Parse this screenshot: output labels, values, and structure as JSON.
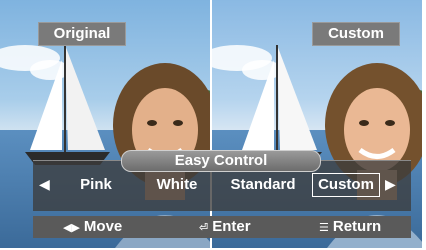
{
  "labels": {
    "left": "Original",
    "right": "Custom"
  },
  "osd": {
    "title": "Easy Control",
    "options": [
      "Pink",
      "White",
      "Standard",
      "Custom"
    ],
    "selected_option": "Custom",
    "left_arrow_icon": "left-arrow-icon",
    "right_arrow_icon": "right-arrow-icon",
    "help": {
      "move": "Move",
      "enter": "Enter",
      "return": "Return"
    },
    "help_icons": [
      "left-right-arrows-icon",
      "enter-icon",
      "menu-icon"
    ]
  },
  "colors": {
    "label_bg": "#7a7a7a",
    "osd_bg": "#3c3c3c",
    "help_bg": "#5a5a5a",
    "text": "#ffffff"
  }
}
